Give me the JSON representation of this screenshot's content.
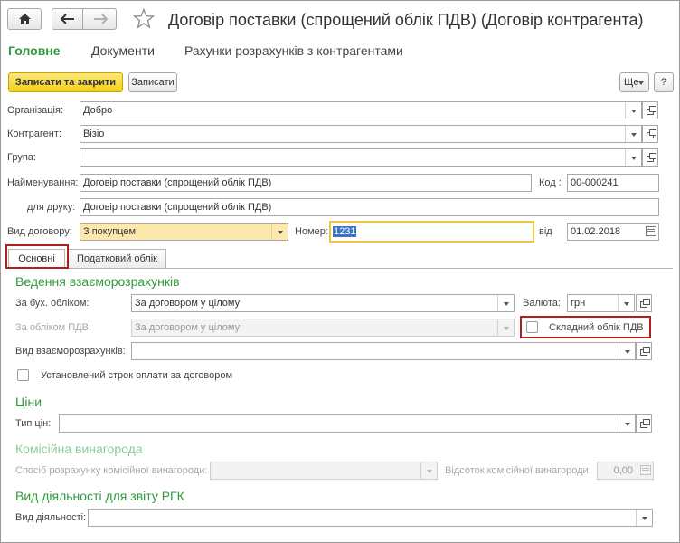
{
  "window": {
    "title": "Договір поставки (спрощений облік ПДВ) (Договір контрагента)",
    "menu_icon": "⋮",
    "close_icon": "×"
  },
  "sections": [
    "Головне",
    "Документи",
    "Рахунки розрахунків з контрагентами"
  ],
  "toolbar": {
    "save_close": "Записати та закрити",
    "save": "Записати",
    "more": "Ще",
    "help": "?"
  },
  "form": {
    "org_label": "Організація:",
    "org_value": "Добро",
    "contractor_label": "Контрагент:",
    "contractor_value": "Візіо",
    "group_label": "Група:",
    "group_value": "",
    "name_label": "Найменування:",
    "name_value": "Договір поставки (спрощений облік ПДВ)",
    "code_label": "Код :",
    "code_value": "00-000241",
    "print_label": "для друку:",
    "print_value": "Договір поставки (спрощений облік ПДВ)",
    "type_label": "Вид договору:",
    "type_value": "З покупцем",
    "number_label": "Номер:",
    "number_value": "1231",
    "date_label": "від",
    "date_value": "01.02.2018"
  },
  "tabs": [
    "Основні",
    "Податковий облік"
  ],
  "settlement": {
    "heading": "Ведення взаєморозрахунків",
    "account_label": "За бух. обліком:",
    "account_value": "За договором у цілому",
    "currency_label": "Валюта:",
    "currency_value": "грн",
    "vat_label": "За обліком ПДВ:",
    "vat_value": "За договором у цілому",
    "complex_vat_label": "Складний облік ПДВ",
    "complex_vat_checked": false,
    "kind_label": "Вид взаєморозрахунків:",
    "kind_value": "",
    "term_label": "Установлений строк оплати за договором",
    "term_checked": false
  },
  "prices": {
    "heading": "Ціни",
    "type_label": "Тип цін:",
    "type_value": ""
  },
  "commission": {
    "heading": "Комісійна винагорода",
    "method_label": "Спосіб розрахунку комісійної винагороди:",
    "method_value": "",
    "percent_label": "Відсоток комісійної винагороди:",
    "percent_value": "0,00"
  },
  "activity": {
    "heading": "Вид діяльності для звіту РГК",
    "kind_label": "Вид діяльності:",
    "kind_value": ""
  },
  "colors": {
    "accent_green": "#2e9a3c",
    "primary_yellow": "#f2cf1a",
    "highlight_red": "#b01e1e",
    "focus_border": "#f1c33f"
  }
}
